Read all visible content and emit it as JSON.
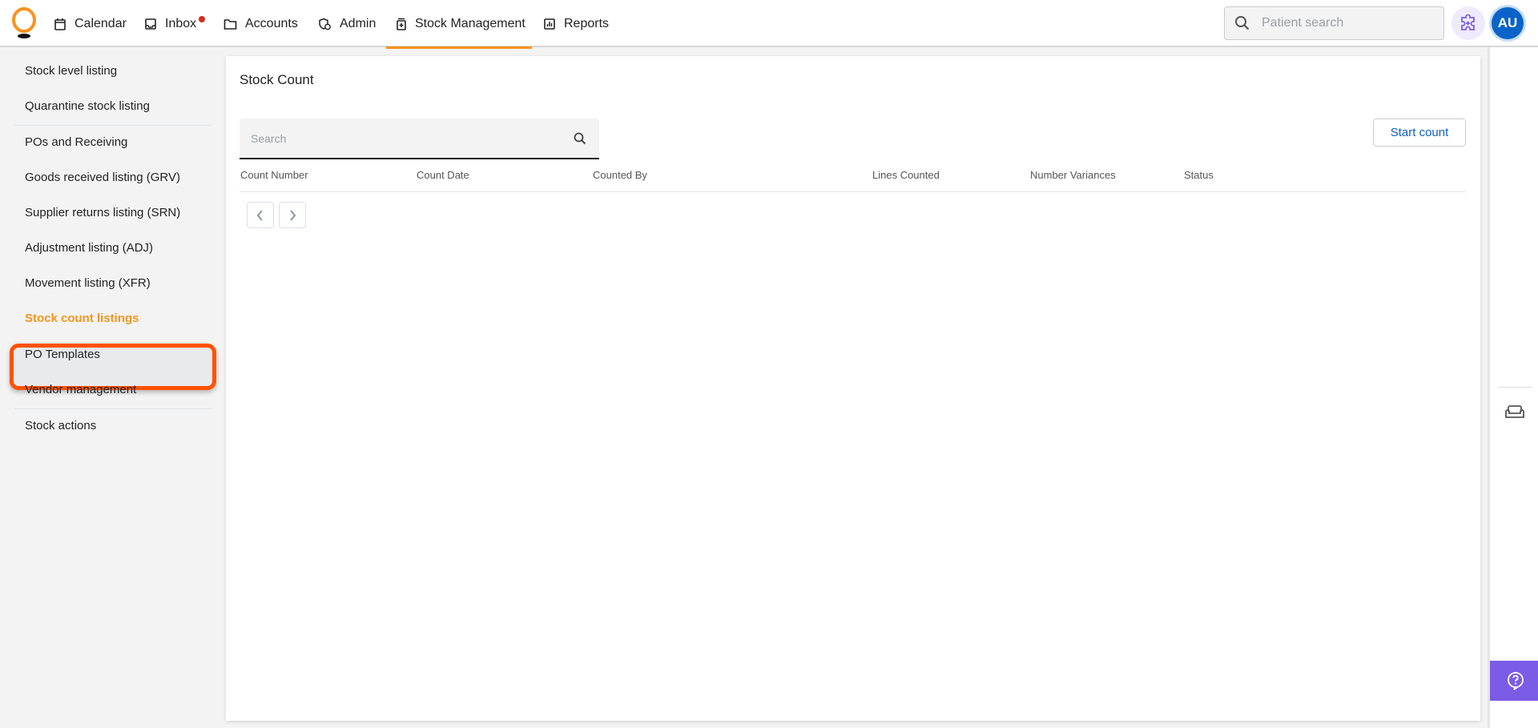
{
  "header": {
    "nav": [
      {
        "label": "Calendar",
        "icon": "calendar-icon"
      },
      {
        "label": "Inbox",
        "icon": "inbox-icon",
        "has_notification": true
      },
      {
        "label": "Accounts",
        "icon": "folder-icon"
      },
      {
        "label": "Admin",
        "icon": "admin-icon"
      },
      {
        "label": "Stock Management",
        "icon": "medicine-icon",
        "active": true
      },
      {
        "label": "Reports",
        "icon": "reports-icon"
      }
    ],
    "patient_search_placeholder": "Patient search",
    "avatar_initials": "AU",
    "colors": {
      "accent": "#f7941d",
      "avatar": "#0a63c9",
      "notification": "#d62d20"
    }
  },
  "sidebar": {
    "items": [
      {
        "label": "Stock level listing"
      },
      {
        "label": "Quarantine stock listing"
      },
      {
        "label": "POs and Receiving"
      },
      {
        "label": "Goods received listing (GRV)"
      },
      {
        "label": "Supplier returns listing (SRN)"
      },
      {
        "label": "Adjustment listing (ADJ)"
      },
      {
        "label": "Movement listing (XFR)"
      },
      {
        "label": "Stock count listings",
        "active": true
      },
      {
        "label": "PO Templates"
      },
      {
        "label": "Vendor management"
      },
      {
        "label": "Stock actions"
      }
    ]
  },
  "main": {
    "title": "Stock Count",
    "search_placeholder": "Search",
    "start_count_label": "Start count",
    "columns": [
      "Count Number",
      "Count Date",
      "Counted By",
      "Lines Counted",
      "Number Variances",
      "Status"
    ],
    "rows": []
  },
  "rail": {
    "help_color": "#7b5ce6"
  }
}
